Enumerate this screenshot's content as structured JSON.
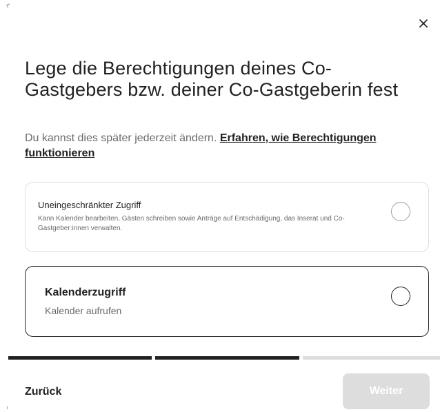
{
  "dialog": {
    "title": "Lege die Berechtigungen deines Co-Gastgebers bzw. deiner Co-Gastgeberin fest",
    "subtitle_text": "Du kannst dies später jederzeit ändern. ",
    "learn_more_link": "Erfahren, wie Berechtigungen funktionieren",
    "close_icon": "close-icon"
  },
  "options": [
    {
      "title": "Uneingeschränkter Zugriff",
      "description": "Kann Kalender bearbeiten, Gästen schreiben sowie Anträge auf Entschädigung, das Inserat und Co-Gastgeber:innen verwalten.",
      "selected": false
    },
    {
      "title": "Kalenderzugriff",
      "description": "Kalender aufrufen",
      "selected": false
    }
  ],
  "progress": {
    "total_steps": 3,
    "completed_steps": 2
  },
  "footer": {
    "back_label": "Zurück",
    "next_label": "Weiter",
    "next_enabled": false
  },
  "colors": {
    "text_primary": "#222222",
    "text_secondary": "#6a6a6a",
    "border_light": "#dddddd",
    "disabled_button": "#dddddd"
  }
}
